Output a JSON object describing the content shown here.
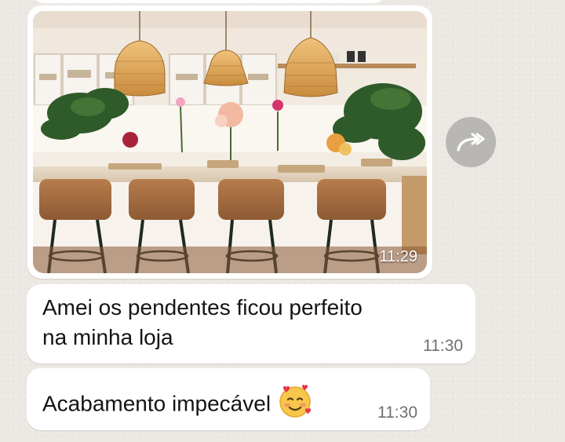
{
  "chat": {
    "messages": [
      {
        "type": "image",
        "image_icon": "kitchen-photo",
        "time": "11:29"
      },
      {
        "type": "text",
        "text_line1": "Amei os pendentes ficou perfeito",
        "text_line2": "na minha loja",
        "time": "11:30"
      },
      {
        "type": "text",
        "text": "Acabamento impecável",
        "emoji": "smiling-face-with-hearts",
        "time": "11:30"
      }
    ],
    "forward_icon": "forward-arrow-icon"
  },
  "colors": {
    "chat_bg": "#ece9e4",
    "bubble": "#ffffff",
    "forward_btn": "#b9b7b3",
    "time_text": "#6f6f6f"
  }
}
